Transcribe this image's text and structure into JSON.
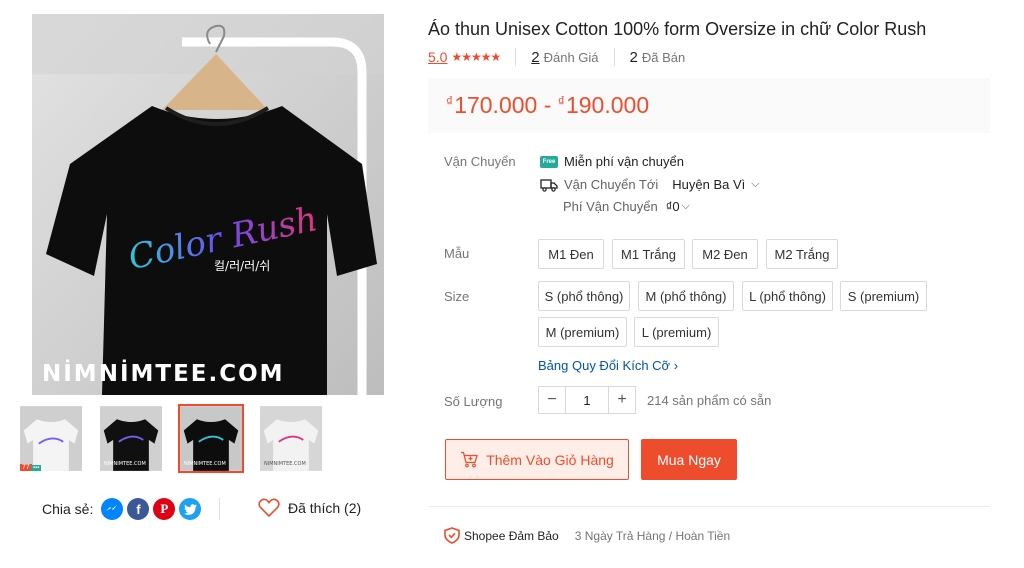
{
  "product": {
    "title": "Áo thun Unisex Cotton 100% form Oversize in chữ Color Rush",
    "rating": "5.0",
    "stars": "★★★★★",
    "reviews_count": "2",
    "reviews_label": "Đánh Giá",
    "sold_count": "2",
    "sold_label": "Đã Bán",
    "price_currency": "₫",
    "price_min": "170.000",
    "price_sep": " - ",
    "price_max": "190.000"
  },
  "image": {
    "watermark": "NİMNİMTEE.COM",
    "print_text": "Color Rush",
    "print_korean": "컬/러/러/쉬"
  },
  "thumbnails": [
    {
      "label": "thumb-white-front",
      "tiny": "nimnimtee.com",
      "badge": "77"
    },
    {
      "label": "thumb-black-hanger",
      "tiny": "NIMNIMTEE.COM"
    },
    {
      "label": "thumb-black-selected",
      "tiny": "NIMNIMTEE.COM"
    },
    {
      "label": "thumb-white-hanger",
      "tiny": "NIMNIMTEE.COM"
    }
  ],
  "share": {
    "label": "Chia sẻ:",
    "liked_label": "Đã thích (2)"
  },
  "shipping": {
    "label": "Vận Chuyển",
    "free_tag": "Free",
    "free_text": "Miễn phí vận chuyển",
    "to_label": "Vận Chuyển Tới",
    "to_value": "Huyện Ba Vì",
    "fee_label": "Phí Vận Chuyển",
    "fee_value": "₫0"
  },
  "variant": {
    "label": "Mẫu",
    "options": [
      "M1 Đen",
      "M1 Trắng",
      "M2 Đen",
      "M2 Trắng"
    ]
  },
  "size": {
    "label": "Size",
    "options": [
      "S (phổ thông)",
      "M (phổ thông)",
      "L (phổ thông)",
      "S (premium)",
      "M (premium)",
      "L (premium)"
    ],
    "chart_link": "Bảng Quy Đổi Kích Cỡ"
  },
  "quantity": {
    "label": "Số Lượng",
    "minus": "−",
    "value": "1",
    "plus": "+",
    "stock": "214 sản phẩm có sẵn"
  },
  "actions": {
    "add_to_cart": "Thêm Vào Giỏ Hàng",
    "buy_now": "Mua Ngay"
  },
  "guarantee": {
    "brand": "Shopee Đảm Bảo",
    "text": "3 Ngày Trả Hàng / Hoàn Tiền"
  },
  "colors": {
    "accent": "#ee4d2d",
    "link": "#0055aa",
    "free_ship": "#26aa99"
  }
}
